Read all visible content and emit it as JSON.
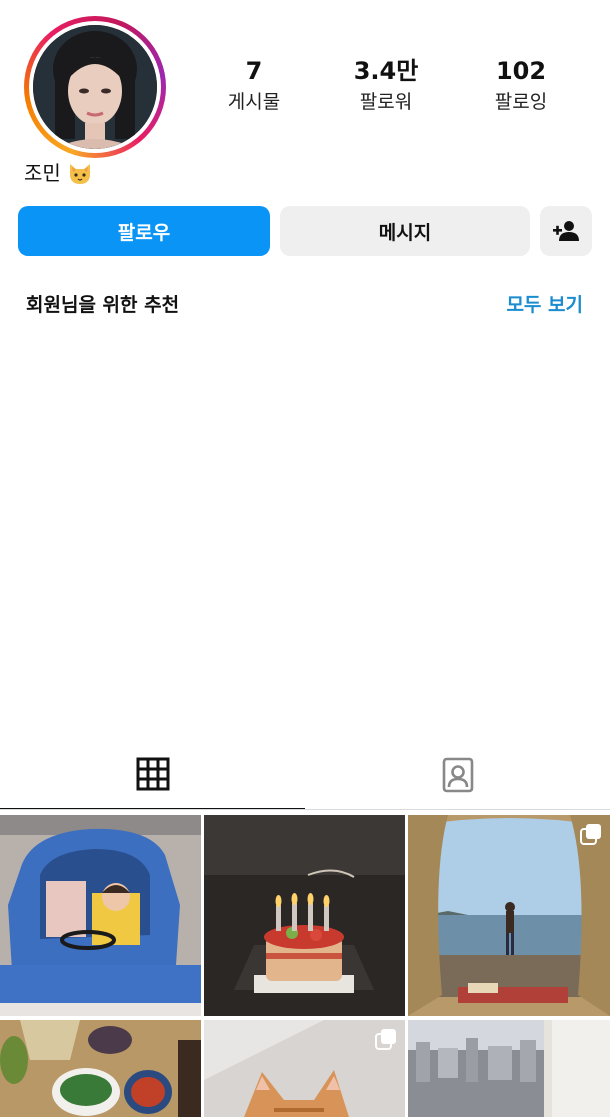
{
  "profile": {
    "name": "조민",
    "name_emoji": "cat-face",
    "stats": [
      {
        "value": "7",
        "label": "게시물"
      },
      {
        "value": "3.4만",
        "label": "팔로워"
      },
      {
        "value": "102",
        "label": "팔로잉"
      }
    ]
  },
  "actions": {
    "follow": "팔로우",
    "message": "메시지",
    "add_user_icon": "person-add-icon"
  },
  "recommendations": {
    "title": "회원님을 위한 추천",
    "see_all": "모두 보기"
  },
  "tabs": [
    {
      "icon": "grid-icon",
      "active": true
    },
    {
      "icon": "tagged-person-icon",
      "active": false
    }
  ],
  "posts": [
    {
      "description": "child in blue toy car",
      "multiple": false
    },
    {
      "description": "birthday cake with 2023 candles",
      "multiple": false
    },
    {
      "description": "person on beach seen from tent",
      "multiple": true
    },
    {
      "description": "dishes of food on table",
      "multiple": false
    },
    {
      "description": "orange cat",
      "multiple": true
    },
    {
      "description": "city view through window",
      "multiple": false
    }
  ],
  "colors": {
    "accent": "#0a95f6",
    "link": "#1a8ccf",
    "button_gray": "#efefef"
  }
}
